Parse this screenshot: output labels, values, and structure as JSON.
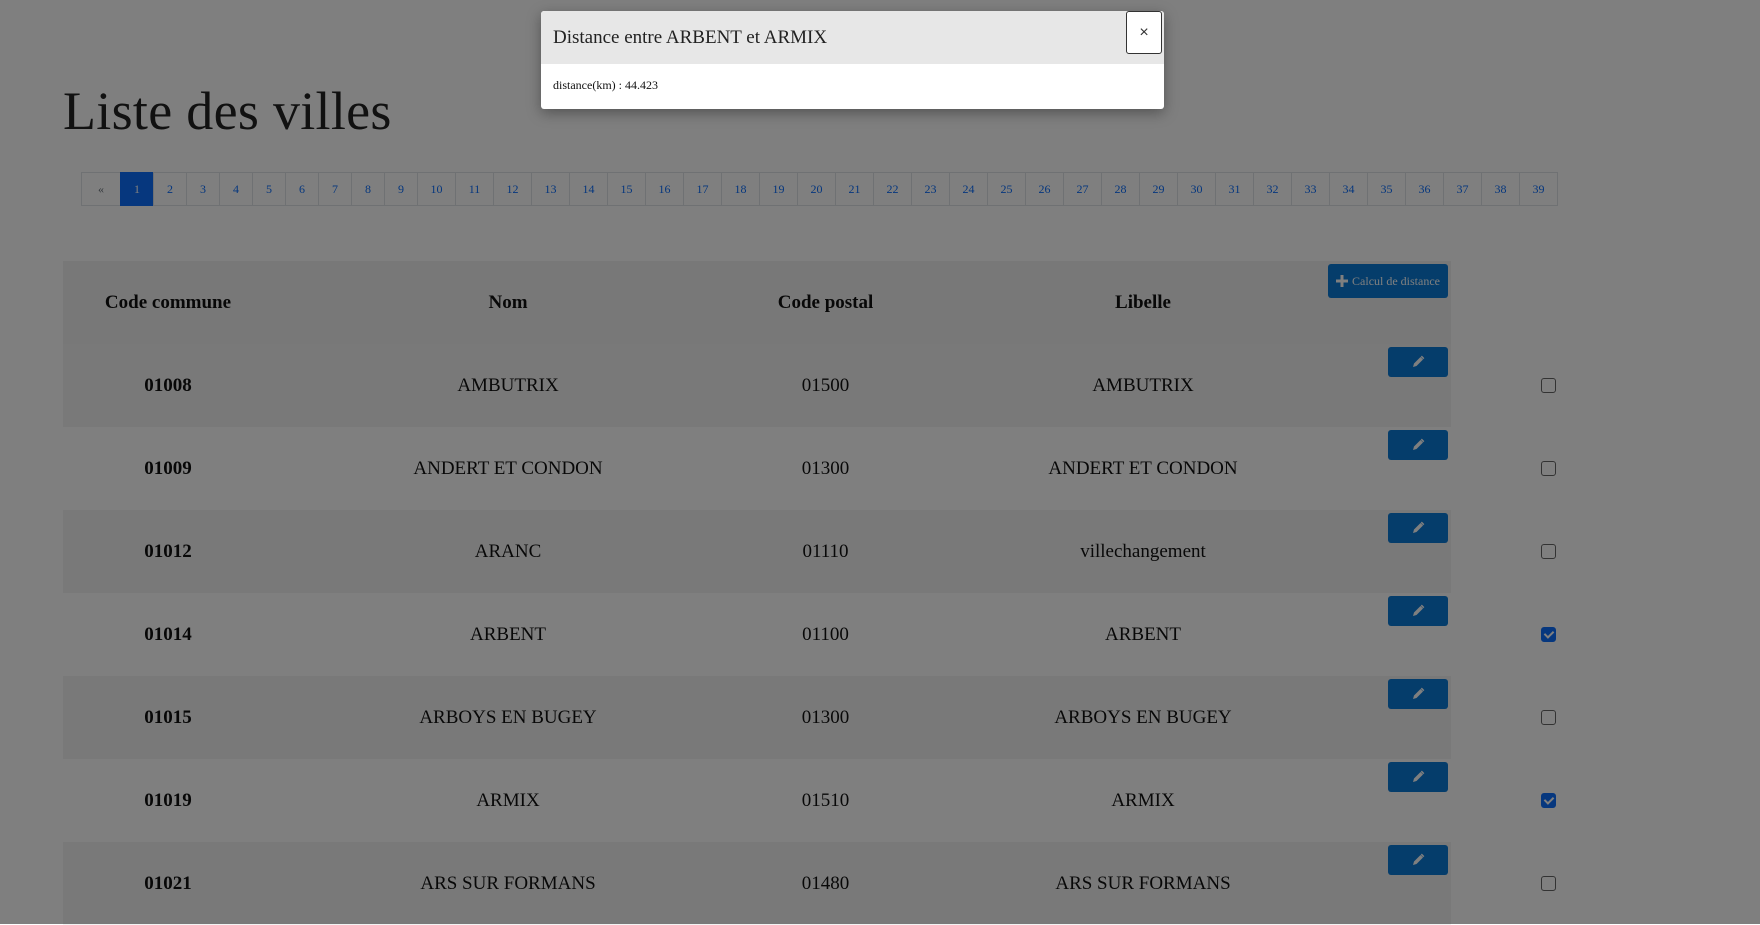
{
  "page": {
    "title": "Liste des villes"
  },
  "pagination": {
    "prev": "«",
    "active": "1",
    "pages": [
      "1",
      "2",
      "3",
      "4",
      "5",
      "6",
      "7",
      "8",
      "9",
      "10",
      "11",
      "12",
      "13",
      "14",
      "15",
      "16",
      "17",
      "18",
      "19",
      "20",
      "21",
      "22",
      "23",
      "24",
      "25",
      "26",
      "27",
      "28",
      "29",
      "30",
      "31",
      "32",
      "33",
      "34",
      "35",
      "36",
      "37",
      "38",
      "39"
    ]
  },
  "table": {
    "headers": {
      "code": "Code commune",
      "nom": "Nom",
      "cp": "Code postal",
      "libelle": "Libelle"
    },
    "calc_button": "Calcul de distance",
    "rows": [
      {
        "code": "01008",
        "nom": "AMBUTRIX",
        "cp": "01500",
        "libelle": "AMBUTRIX",
        "checked": false
      },
      {
        "code": "01009",
        "nom": "ANDERT ET CONDON",
        "cp": "01300",
        "libelle": "ANDERT ET CONDON",
        "checked": false
      },
      {
        "code": "01012",
        "nom": "ARANC",
        "cp": "01110",
        "libelle": "villechangement",
        "checked": false
      },
      {
        "code": "01014",
        "nom": "ARBENT",
        "cp": "01100",
        "libelle": "ARBENT",
        "checked": true
      },
      {
        "code": "01015",
        "nom": "ARBOYS EN BUGEY",
        "cp": "01300",
        "libelle": "ARBOYS EN BUGEY",
        "checked": false
      },
      {
        "code": "01019",
        "nom": "ARMIX",
        "cp": "01510",
        "libelle": "ARMIX",
        "checked": true
      },
      {
        "code": "01021",
        "nom": "ARS SUR FORMANS",
        "cp": "01480",
        "libelle": "ARS SUR FORMANS",
        "checked": false
      }
    ]
  },
  "modal": {
    "title": "Distance entre ARBENT et ARMIX",
    "close": "×",
    "body": "distance(km) : 44.423"
  },
  "colors": {
    "primary": "#0d6efd",
    "button": "#0a7ad6",
    "overlay": "rgba(0,0,0,0.5)"
  }
}
